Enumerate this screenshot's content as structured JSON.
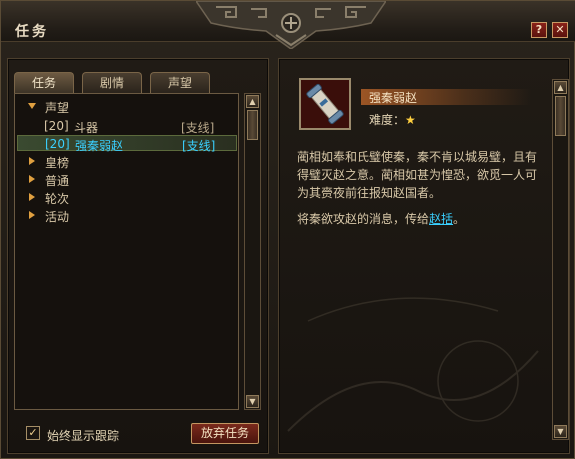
{
  "window": {
    "title": "任务"
  },
  "buttons": {
    "help": "?",
    "close": "✕",
    "abandon": "放弃任务"
  },
  "tabs": [
    {
      "label": "任务",
      "active": true
    },
    {
      "label": "剧情",
      "active": false
    },
    {
      "label": "声望",
      "active": false
    }
  ],
  "tree": {
    "groups": [
      {
        "label": "声望",
        "expanded": true
      },
      {
        "label": "皇榜",
        "expanded": false
      },
      {
        "label": "普通",
        "expanded": false
      },
      {
        "label": "轮次",
        "expanded": false
      },
      {
        "label": "活动",
        "expanded": false
      }
    ],
    "quests": [
      {
        "level": "[20]",
        "name": "斗器",
        "type": "[支线]",
        "selected": false
      },
      {
        "level": "[20]",
        "name": "强秦弱赵",
        "type": "[支线]",
        "selected": true
      }
    ]
  },
  "options": {
    "always_track_label": "始终显示跟踪",
    "always_track_checked": true
  },
  "detail": {
    "title": "强秦弱赵",
    "difficulty_label": "难度：",
    "difficulty_stars": "★",
    "description": "蔺相如奉和氏璧使秦，秦不肯以城易璧，且有得璧灭赵之意。蔺相如甚为惶恐，欲觅一人可为其赍夜前往报知赵国者。",
    "goal_prefix": "将秦欲攻赵的消息，传给",
    "goal_npc": "赵括",
    "goal_suffix": "。"
  },
  "colors": {
    "accent_link": "#3ad0ff",
    "title_highlight": "#b26028",
    "button_red": "#7a2a1c",
    "star": "#ffd040"
  },
  "icons": {
    "quest_item": "scroll-icon",
    "help": "help-icon",
    "close": "close-icon"
  }
}
